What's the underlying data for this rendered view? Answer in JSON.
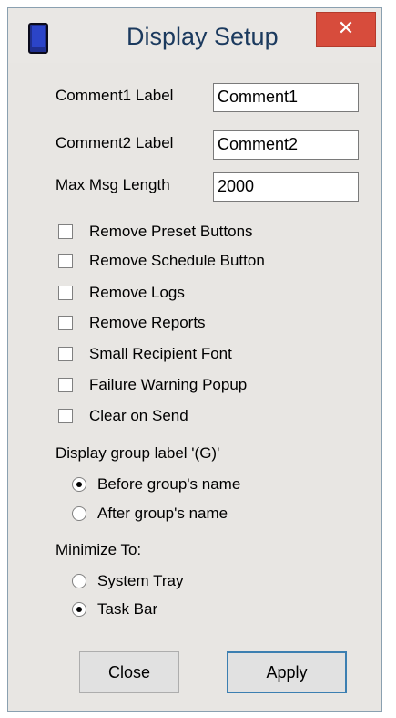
{
  "window": {
    "title": "Display Setup",
    "close_glyph": "✕"
  },
  "fields": [
    {
      "label": "Comment1 Label",
      "value": "Comment1"
    },
    {
      "label": "Comment2 Label",
      "value": "Comment2"
    },
    {
      "label": "Max Msg Length",
      "value": "2000"
    }
  ],
  "checkboxes": [
    {
      "label": "Remove Preset Buttons",
      "checked": false
    },
    {
      "label": "Remove Schedule Button",
      "checked": false
    },
    {
      "label": "Remove Logs",
      "checked": false
    },
    {
      "label": "Remove Reports",
      "checked": false
    },
    {
      "label": "Small Recipient Font",
      "checked": false
    },
    {
      "label": "Failure Warning Popup",
      "checked": false
    },
    {
      "label": "Clear on Send",
      "checked": false
    }
  ],
  "group_label": {
    "heading": "Display group label '(G)'",
    "options": [
      {
        "label": "Before group's name",
        "selected": true
      },
      {
        "label": "After group's name",
        "selected": false
      }
    ]
  },
  "minimize": {
    "heading": "Minimize To:",
    "options": [
      {
        "label": "System Tray",
        "selected": false
      },
      {
        "label": "Task Bar",
        "selected": true
      }
    ]
  },
  "buttons": {
    "close": "Close",
    "apply": "Apply"
  },
  "colors": {
    "close_button_bg": "#d74c3c",
    "title_text": "#1b3a5e",
    "window_bg": "#e8e6e3"
  }
}
